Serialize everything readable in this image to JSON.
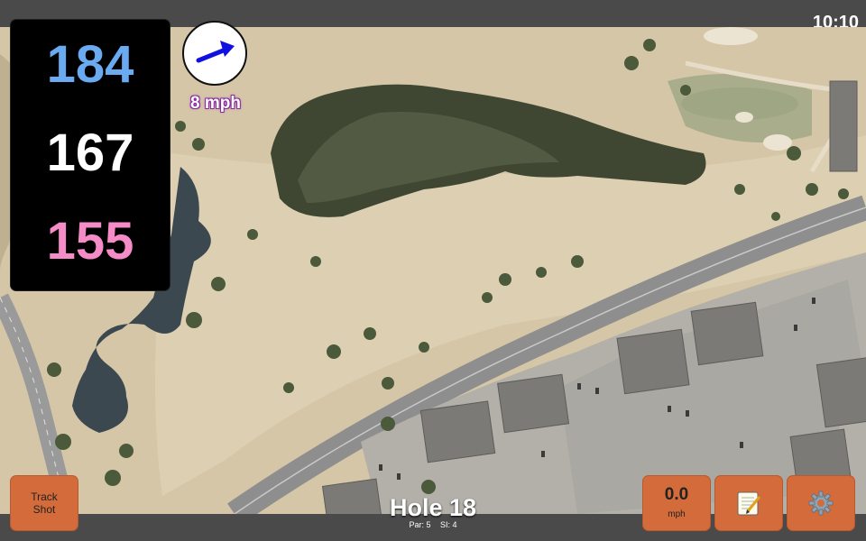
{
  "status_bar": {
    "time": "10:10"
  },
  "distances": {
    "back": "184",
    "middle": "167",
    "front": "155",
    "colors": {
      "back": "#6aaaf0",
      "middle": "#ffffff",
      "front": "#f58cc8"
    }
  },
  "wind": {
    "speed": "8 mph",
    "icon": "arrow-icon",
    "arrow_color": "#1010e0"
  },
  "hole": {
    "title": "Hole 18",
    "par": "Par: 5",
    "si": "SI: 4"
  },
  "buttons": {
    "track_shot": [
      "Track",
      "Shot"
    ],
    "speed_value": "0.0",
    "speed_unit": "mph",
    "notes_icon": "notepad-icon",
    "settings_icon": "gear-icon"
  },
  "colors": {
    "button": "#d36b3a",
    "bar": "#4a4a4a",
    "accent_outline": "#8a2aa0"
  }
}
